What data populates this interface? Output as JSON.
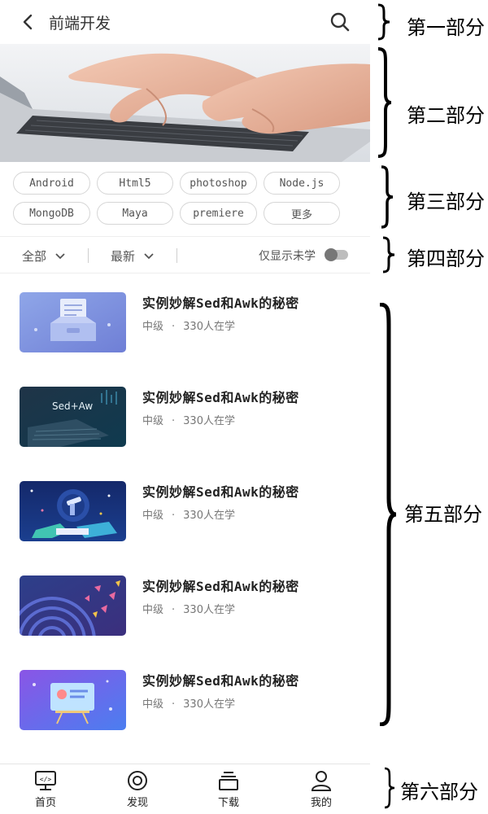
{
  "header": {
    "title": "前端开发"
  },
  "tags": [
    {
      "label": "Android"
    },
    {
      "label": "Html5"
    },
    {
      "label": "photoshop"
    },
    {
      "label": "Node.js"
    },
    {
      "label": "MongoDB"
    },
    {
      "label": "Maya"
    },
    {
      "label": "premiere"
    },
    {
      "label": "更多"
    }
  ],
  "filters": {
    "all_label": "全部",
    "latest_label": "最新",
    "unlearned_label": "仅显示未学",
    "unlearned_enabled": false
  },
  "courses": [
    {
      "title": "实例妙解Sed和Awk的秘密",
      "level": "中级",
      "dot": "·",
      "learners": "330人在学",
      "thumb": "inbox-illustration"
    },
    {
      "title": "实例妙解Sed和Awk的秘密",
      "level": "中级",
      "dot": "·",
      "learners": "330人在学",
      "thumb": "sed-awk-laptop",
      "thumb_text": "Sed+Aw"
    },
    {
      "title": "实例妙解Sed和Awk的秘密",
      "level": "中级",
      "dot": "·",
      "learners": "330人在学",
      "thumb": "telescope-illustration"
    },
    {
      "title": "实例妙解Sed和Awk的秘密",
      "level": "中级",
      "dot": "·",
      "learners": "330人在学",
      "thumb": "radar-illustration"
    },
    {
      "title": "实例妙解Sed和Awk的秘密",
      "level": "中级",
      "dot": "·",
      "learners": "330人在学",
      "thumb": "presentation-illustration"
    }
  ],
  "bottom_nav": [
    {
      "label": "首页",
      "icon": "home-screen-icon"
    },
    {
      "label": "发现",
      "icon": "discover-icon"
    },
    {
      "label": "下载",
      "icon": "download-icon"
    },
    {
      "label": "我的",
      "icon": "profile-icon"
    }
  ],
  "annotations": [
    {
      "label": "第一部分"
    },
    {
      "label": "第二部分"
    },
    {
      "label": "第三部分"
    },
    {
      "label": "第四部分"
    },
    {
      "label": "第五部分"
    },
    {
      "label": "第六部分"
    }
  ]
}
